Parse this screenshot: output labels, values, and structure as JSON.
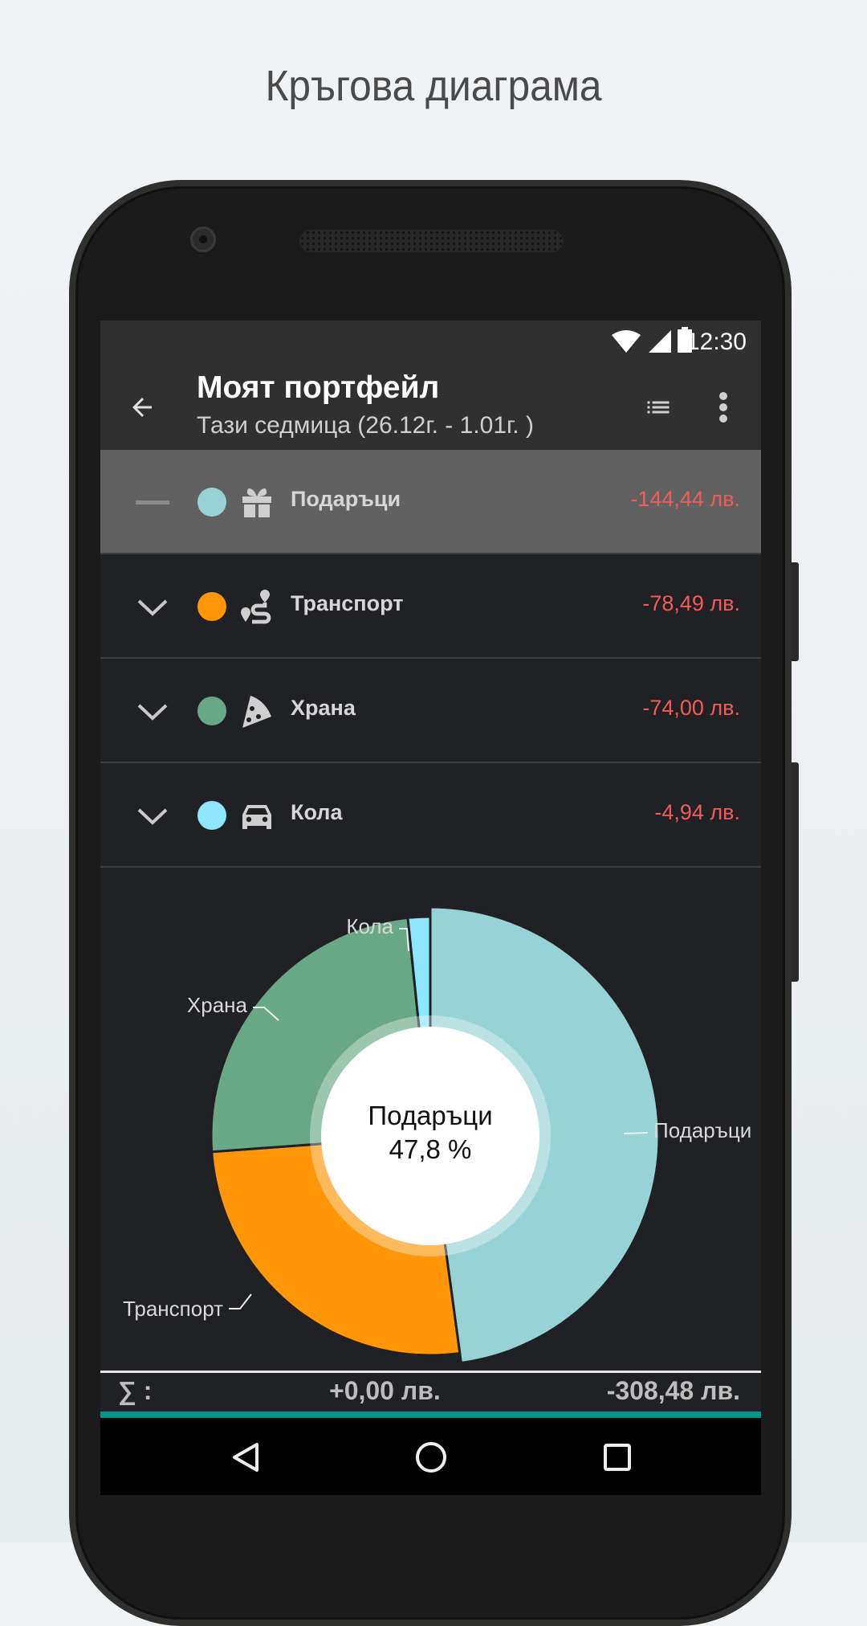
{
  "headline": "Кръгова диаграма",
  "status": {
    "time": "12:30"
  },
  "appbar": {
    "title": "Моят портфейл",
    "subtitle": "Тази седмица (26.12г. - 1.01г. )"
  },
  "categories": [
    {
      "label": "Подаръци",
      "amount": "-144,44 лв.",
      "color": "#97d3d4",
      "icon": "gift-icon",
      "selected": true
    },
    {
      "label": "Транспорт",
      "amount": "-78,49 лв.",
      "color": "#ff9608",
      "icon": "route-icon",
      "selected": false
    },
    {
      "label": "Храна",
      "amount": "-74,00 лв.",
      "color": "#69a886",
      "icon": "pizza-icon",
      "selected": false
    },
    {
      "label": "Кола",
      "amount": "-4,94 лв.",
      "color": "#8de6fb",
      "icon": "car-icon",
      "selected": false
    }
  ],
  "chart_data": {
    "type": "pie",
    "donut": true,
    "categories": [
      "Подаръци",
      "Транспорт",
      "Храна",
      "Кола"
    ],
    "values": [
      144.44,
      78.49,
      74.0,
      4.94
    ],
    "colors": [
      "#97d3d4",
      "#ff9608",
      "#69a886",
      "#8de6fb"
    ],
    "highlighted": "Подаръци",
    "center_label": "Подаръци",
    "center_value": "47,8 %"
  },
  "summary": {
    "sigma": "∑ :",
    "income": "+0,00 лв.",
    "expense": "-308,48 лв."
  }
}
